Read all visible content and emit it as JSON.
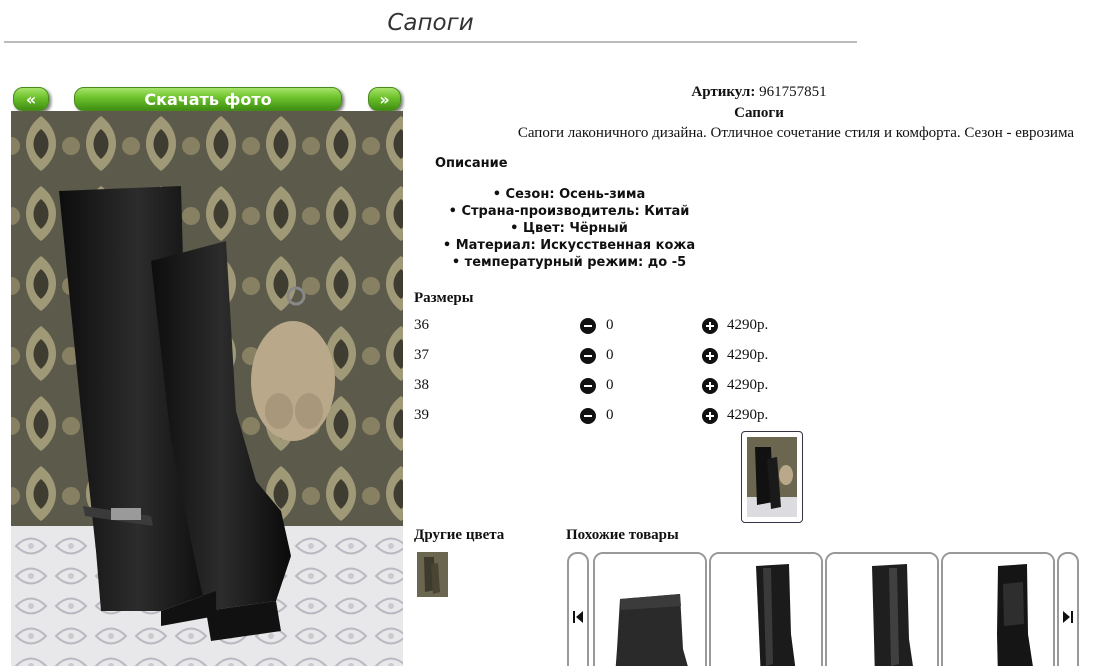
{
  "page": {
    "title": "Сапоги"
  },
  "gallery": {
    "prev_label": "«",
    "download_label": "Скачать фото",
    "next_label": "»"
  },
  "product": {
    "article_label": "Артикул:",
    "article_value": "961757851",
    "name": "Сапоги",
    "short_description": "Сапоги лаконичного дизайна. Отличное сочетание стиля и комфорта. Сезон - еврозима",
    "description_heading": "Описание",
    "features": [
      "• Сезон: Осень-зима",
      "• Страна-производитель: Китай",
      "• Цвет: Чёрный",
      "• Материал: Искусственная кожа",
      "• температурный режим: до -5"
    ]
  },
  "sizes": {
    "heading": "Размеры",
    "rows": [
      {
        "size": "36",
        "qty": "0",
        "price": "4290р."
      },
      {
        "size": "37",
        "qty": "0",
        "price": "4290р."
      },
      {
        "size": "38",
        "qty": "0",
        "price": "4290р."
      },
      {
        "size": "39",
        "qty": "0",
        "price": "4290р."
      }
    ]
  },
  "other_colors": {
    "heading": "Другие цвета"
  },
  "similar": {
    "heading": "Похожие товары"
  },
  "colors": {
    "button_green": "#6cc12a",
    "rule": "#bbbbbb"
  },
  "icons": {
    "minus": "minus-circle-icon",
    "plus": "plus-circle-icon",
    "carousel_prev": "skip-back-icon",
    "carousel_next": "skip-forward-icon"
  }
}
